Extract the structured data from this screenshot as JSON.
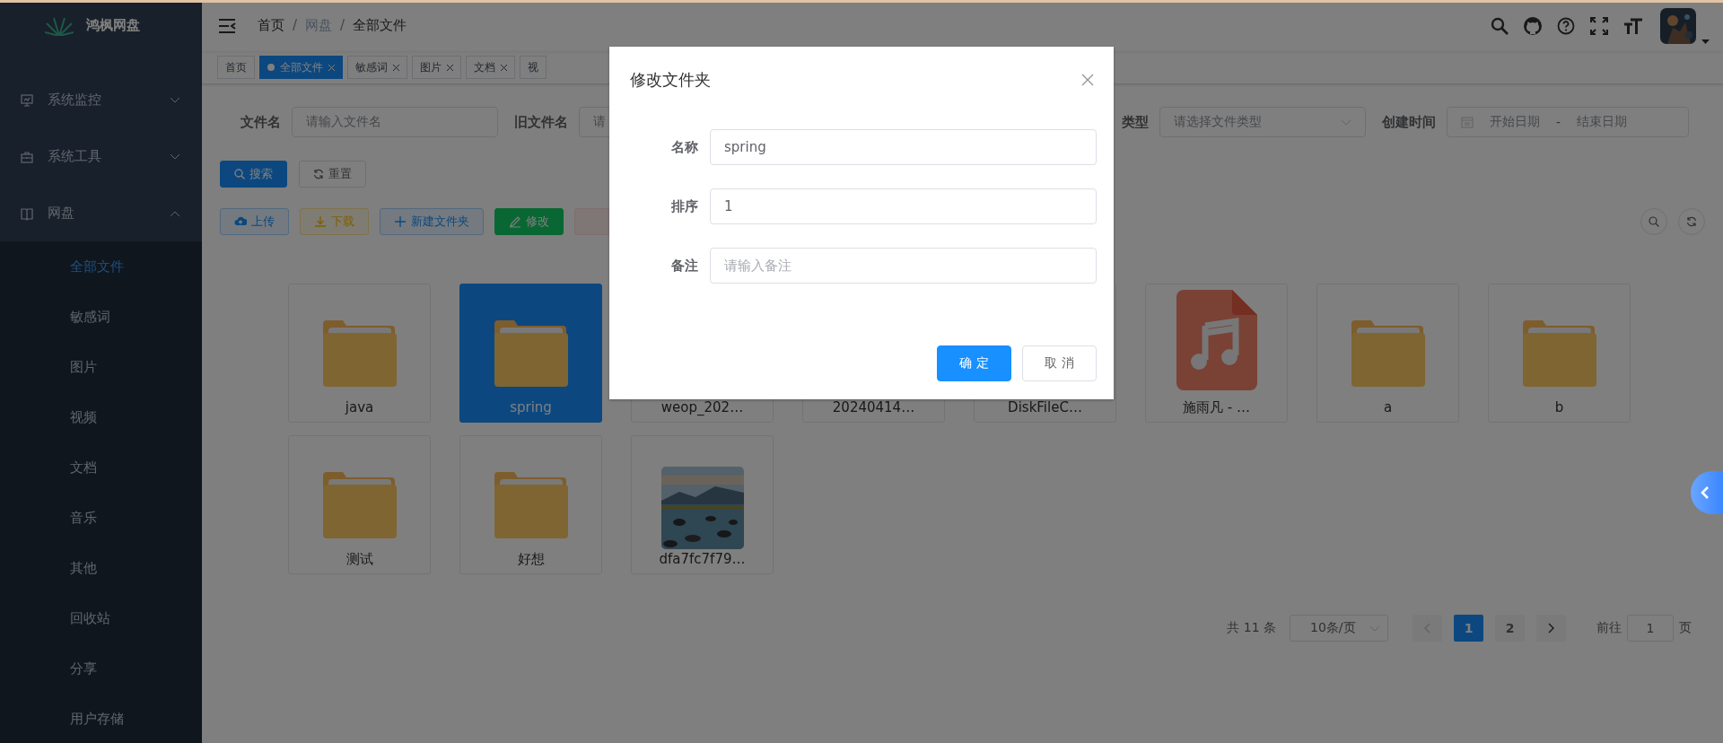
{
  "sidebar": {
    "logo": "鸿枫网盘",
    "menus": [
      {
        "label": "系统监控",
        "expanded": false
      },
      {
        "label": "系统工具",
        "expanded": false
      },
      {
        "label": "网盘",
        "expanded": true,
        "children": [
          {
            "label": "全部文件",
            "selected": true
          },
          {
            "label": "敏感词",
            "selected": false
          },
          {
            "label": "图片",
            "selected": false
          },
          {
            "label": "视频",
            "selected": false
          },
          {
            "label": "文档",
            "selected": false
          },
          {
            "label": "音乐",
            "selected": false
          },
          {
            "label": "其他",
            "selected": false
          },
          {
            "label": "回收站",
            "selected": false
          },
          {
            "label": "分享",
            "selected": false
          },
          {
            "label": "用户存储",
            "selected": false
          }
        ]
      }
    ]
  },
  "header": {
    "breadcrumb": [
      {
        "label": "首页"
      },
      {
        "separator": "/",
        "label": "网盘"
      },
      {
        "separator": "/",
        "label": "全部文件"
      }
    ]
  },
  "tags": [
    {
      "label": "首页",
      "selected": false,
      "closable": false
    },
    {
      "label": "全部文件",
      "selected": true,
      "closable": true
    },
    {
      "label": "敏感词",
      "selected": false,
      "closable": true
    },
    {
      "label": "图片",
      "selected": false,
      "closable": true
    },
    {
      "label": "文档",
      "selected": false,
      "closable": true
    },
    {
      "label": "视",
      "selected": false,
      "closable": false
    }
  ],
  "search": {
    "fields": [
      {
        "label": "文件名",
        "kind": "input",
        "placeholder": "请输入文件名"
      },
      {
        "label": "旧文件名",
        "kind": "input",
        "placeholder": "请"
      },
      {
        "label": "类型",
        "kind": "select",
        "placeholder": "请选择文件类型"
      },
      {
        "label": "创建时间",
        "kind": "daterange",
        "start_placeholder": "开始日期",
        "separator": "-",
        "end_placeholder": "结束日期"
      }
    ],
    "buttons": [
      {
        "label": "搜索",
        "kind": "primary"
      },
      {
        "label": "重置",
        "kind": "default"
      }
    ]
  },
  "toolbar": [
    {
      "label": "上传",
      "kind": "upload"
    },
    {
      "label": "下载",
      "kind": "download"
    },
    {
      "label": "新建文件夹",
      "kind": "create"
    },
    {
      "label": "修改",
      "kind": "edit"
    },
    {
      "kind": "delete"
    }
  ],
  "files": [
    {
      "name": "java",
      "kind": "folder",
      "selected": false
    },
    {
      "name": "spring",
      "kind": "folder",
      "selected": true
    },
    {
      "name": "weop_202…",
      "kind": "covered",
      "selected": false
    },
    {
      "name": "20240414…",
      "kind": "covered",
      "selected": false
    },
    {
      "name": "DiskFileC…",
      "kind": "covered",
      "selected": false
    },
    {
      "name": "施雨凡 - …",
      "kind": "music",
      "selected": false
    },
    {
      "name": "a",
      "kind": "folder",
      "selected": false
    },
    {
      "name": "b",
      "kind": "folder",
      "selected": false
    },
    {
      "name": "测试",
      "kind": "folder",
      "selected": false
    },
    {
      "name": "好想",
      "kind": "folder",
      "selected": false
    },
    {
      "name": "dfa7fc7f79…",
      "selected": false
    }
  ],
  "pagination": {
    "total": "共 11 条",
    "page_size": "10条/页",
    "pages": [
      {
        "label": "1",
        "selected": true
      },
      {
        "label": "2",
        "selected": false
      }
    ],
    "goto_label": "前往",
    "goto_value": "1",
    "goto_suffix": "页"
  },
  "dialog": {
    "title": "修改文件夹",
    "fields": [
      {
        "label": "名称",
        "value": "spring"
      },
      {
        "label": "排序",
        "value": "1"
      },
      {
        "label": "备注",
        "placeholder": "请输入备注"
      }
    ],
    "buttons": [
      {
        "label": "确 定",
        "kind": "primary"
      },
      {
        "label": "取 消",
        "kind": "default"
      }
    ]
  }
}
